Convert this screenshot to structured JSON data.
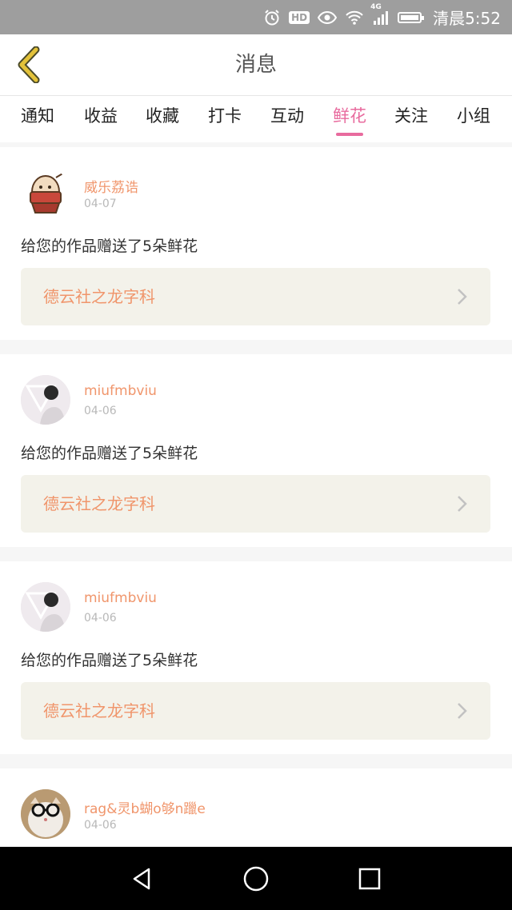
{
  "status_bar": {
    "time": "清晨5:52",
    "hd": "HD",
    "network": "4G",
    "icons": [
      "alarm-icon",
      "hd-icon",
      "eye-icon",
      "wifi-icon",
      "signal-icon",
      "battery-icon"
    ]
  },
  "header": {
    "title": "消息",
    "back_icon": "chevron-left-icon"
  },
  "tabs": [
    {
      "label": "通知",
      "active": false
    },
    {
      "label": "收益",
      "active": false
    },
    {
      "label": "收藏",
      "active": false
    },
    {
      "label": "打卡",
      "active": false
    },
    {
      "label": "互动",
      "active": false
    },
    {
      "label": "鲜花",
      "active": true
    },
    {
      "label": "关注",
      "active": false
    },
    {
      "label": "小组",
      "active": false
    }
  ],
  "messages": [
    {
      "user": "威乐荔诰",
      "date": "04-07",
      "text": "给您的作品赠送了5朵鲜花",
      "work": "德云社之龙字科"
    },
    {
      "user": "miufmbviu",
      "date": "04-06",
      "text": "给您的作品赠送了5朵鲜花",
      "work": "德云社之龙字科"
    },
    {
      "user": "miufmbviu",
      "date": "04-06",
      "text": "给您的作品赠送了5朵鲜花",
      "work": "德云社之龙字科"
    },
    {
      "user": "rag&灵b蝴o够n躐e",
      "date": "04-06"
    }
  ],
  "nav_bar": {
    "icons": [
      "back-triangle-icon",
      "home-circle-icon",
      "recents-square-icon"
    ]
  },
  "colors": {
    "accent": "#e86b9e",
    "username": "#f0956b",
    "link_bg": "#f3f2ea",
    "back_icon": "#e3c23a"
  }
}
